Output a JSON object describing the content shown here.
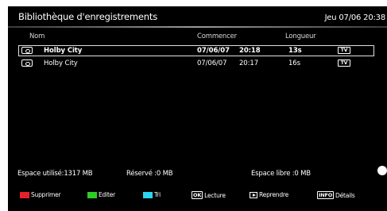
{
  "header": {
    "title": "Bibliothèque d'enregistrements",
    "clock": "Jeu 07/06 20:38"
  },
  "columns": {
    "name": "Nom",
    "start": "Commencer",
    "length": "Longueur"
  },
  "recordings": [
    {
      "name": "Holby City",
      "date": "07/06/07",
      "time": "20:18",
      "length": "13s",
      "type": "TV",
      "selected": true
    },
    {
      "name": "Holby City",
      "date": "07/06/07",
      "time": "20:17",
      "length": "16s",
      "type": "TV",
      "selected": false
    }
  ],
  "stats": {
    "used": "Espace utilisé:1317 MB",
    "reserved": "Réservé :0 MB",
    "free": "Espace libre :0 MB"
  },
  "hints": {
    "delete": "Supprimer",
    "edit": "Editer",
    "sort": "Tri",
    "ok_key": "OK",
    "play": "Lecture",
    "resume": "Reprendre",
    "info_key": "INFO",
    "details": "Détails"
  },
  "colors": {
    "red": "#e8202a",
    "green": "#2ecc27",
    "cyan": "#2bd6ee"
  }
}
